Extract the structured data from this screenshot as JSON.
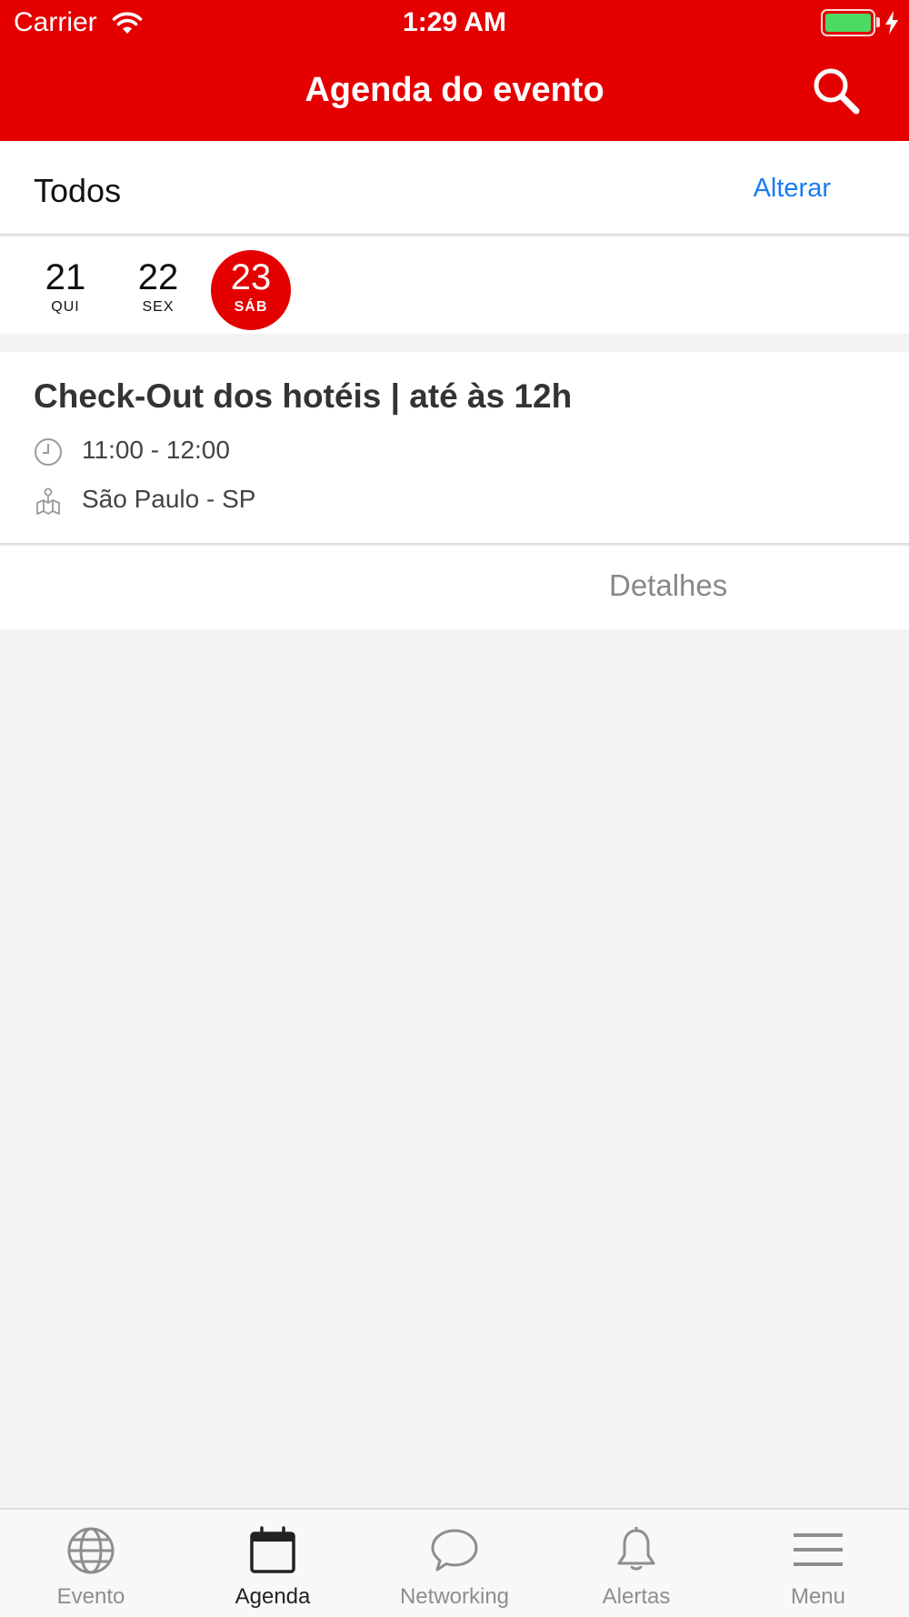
{
  "status_bar": {
    "carrier": "Carrier",
    "time": "1:29 AM",
    "wifi_icon": "wifi-icon",
    "battery_icon": "battery-charging-icon",
    "battery_level": 1.0
  },
  "header": {
    "title": "Agenda do evento",
    "search_icon": "search-icon",
    "background_color": "#e50000"
  },
  "filter": {
    "label": "Todos",
    "action_label": "Alterar",
    "action_color": "#1a7cf0"
  },
  "dates": [
    {
      "day": "21",
      "weekday": "QUI",
      "selected": false
    },
    {
      "day": "22",
      "weekday": "SEX",
      "selected": false
    },
    {
      "day": "23",
      "weekday": "SÁB",
      "selected": true
    }
  ],
  "event": {
    "title": "Check-Out dos hotéis | até às 12h",
    "time": "11:00 - 12:00",
    "time_icon": "clock-icon",
    "location": "São Paulo - SP",
    "location_icon": "map-pin-icon",
    "details_label": "Detalhes"
  },
  "tab_bar": {
    "active_index": 1,
    "tabs": [
      {
        "label": "Evento",
        "icon": "globe-icon"
      },
      {
        "label": "Agenda",
        "icon": "calendar-icon"
      },
      {
        "label": "Networking",
        "icon": "chat-bubble-icon"
      },
      {
        "label": "Alertas",
        "icon": "bell-icon"
      },
      {
        "label": "Menu",
        "icon": "hamburger-menu-icon"
      }
    ]
  }
}
